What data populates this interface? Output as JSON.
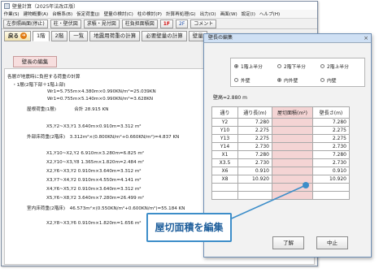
{
  "window": {
    "title": "壁量計算（2025年法改正版）",
    "menu": [
      "作業(S)",
      "建物概要(A)",
      "台帳系(B)",
      "仮定荷重(J)",
      "壁量の検討(C)",
      "柱の検討(P)",
      "計算再処理(G)",
      "出力(O)",
      "画面(W)",
      "設定(I)",
      "ヘルプ(H)"
    ],
    "toolbar": {
      "left_label": "左参照画面(停止)",
      "b1": "柱・壁伏図",
      "b2": "求積・見付図",
      "b3": "柱負担面積図",
      "floor1": "1F",
      "floor2": "2F",
      "comment": "コメント"
    },
    "nav": {
      "back": "戻る",
      "tabs": [
        "1階",
        "2階",
        "一覧",
        "地震用荷重の計算",
        "必要壁量の計算",
        "壁量"
      ]
    },
    "edit_button": "壁長の編集",
    "calc_lines": [
      "各層が地震時に負担する荷重の計算",
      "・1層(2階下部＋1階上部)",
      "Wr1=5.755m×4.380m×0.990KN/m²=25.039KN",
      "Wr1=0.755m×5.140m×0.990KN/m²=3.628KN",
      "屋根荷重(1層)　　　　合計 28.915 KN",
      "X5,Y2~X3,Y1  3.640m×0.910m=3.312 m²",
      "外部床荷重(2階床)　3.312m²×(0.800KN/m²+0.660KN/m²)=4.837 KN",
      "X1,Y10~X2,Y2  6.910m×3.280m=6.825 m²",
      "X2,Y10~X3,Y8  1.365m×1.820m=2.484 m²",
      "X2,Y6~X3,Y2  0.910m×3.640m=3.312 m²",
      "X3,Y7~X4,Y2  0.910m×4.550m=4.141 m²",
      "X4,Y6~X5,Y2  0.910m×3.640m=3.312 m²",
      "X5,Y6~X8,Y2  3.640m×7.280m=26.499 m²",
      "室内床荷重(2階床)　46.573m²×(0.550KN/m²+0.600KN/m²)=55.184 KN",
      "X2,Y8~X3,Y6  0.910m×1.820m=1.656 m²"
    ],
    "dialog": {
      "title": "壁長の編集",
      "close": "×",
      "radios_row1": [
        {
          "label": "1階上半分",
          "selected": true
        },
        {
          "label": "2階下半分",
          "selected": false
        },
        {
          "label": "2階上半分",
          "selected": false
        }
      ],
      "radios_row2": [
        {
          "label": "外壁",
          "selected": false
        },
        {
          "label": "内外壁",
          "selected": true
        },
        {
          "label": "内壁",
          "selected": false
        }
      ],
      "height_label": "壁高=2.880 m",
      "columns": [
        "通り",
        "通り長(m)",
        "屋切面積(m²)",
        "壁長さ(m)"
      ],
      "rows": [
        [
          "Y2",
          "7.280",
          "",
          "7.280"
        ],
        [
          "Y10",
          "2.275",
          "",
          "2.275"
        ],
        [
          "Y13",
          "2.275",
          "",
          "2.275"
        ],
        [
          "Y14",
          "2.730",
          "",
          "2.730"
        ],
        [
          "X1",
          "7.280",
          "",
          "7.280"
        ],
        [
          "X3.5",
          "2.730",
          "",
          "2.730"
        ],
        [
          "X6",
          "0.910",
          "",
          "0.910"
        ],
        [
          "X8",
          "10.920",
          "",
          "10.920"
        ],
        [
          "",
          "",
          "",
          ""
        ],
        [
          "",
          "",
          "",
          ""
        ]
      ],
      "ok": "了解",
      "cancel": "中止"
    },
    "callout": "屋切面積を編集"
  }
}
